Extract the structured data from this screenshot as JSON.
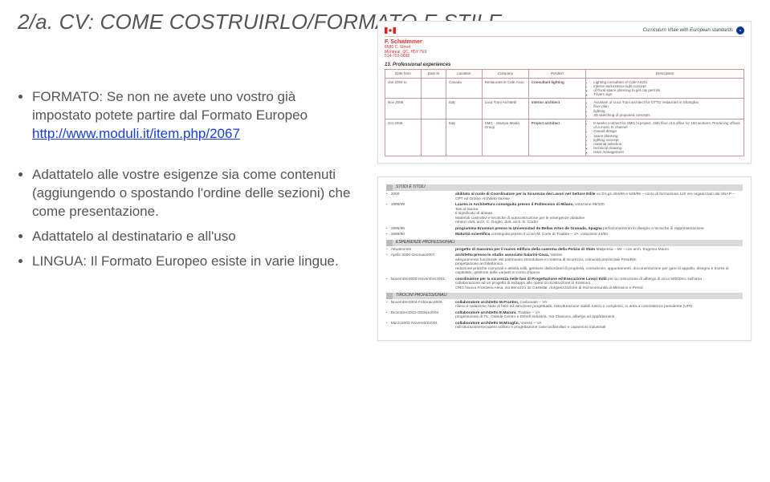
{
  "title": "2/a. CV: COME COSTRUIRLO/FORMATO E STILE",
  "bullets": {
    "b1_line1": "FORMATO: Se non ne avete uno vostro già impostato potete partire dal Formato Europeo",
    "b1_link": "http://www.moduli.it/item.php/2067",
    "b2": "Adattatelo alle vostre esigenze sia come contenuti (aggiungendo o spostando l'ordine delle sezioni) che come presentazione.",
    "b3": "Adattatelo al destinatario e all'uso",
    "b4": "LINGUA: Il Formato Europeo esiste in varie lingue."
  },
  "cv1": {
    "header_label": "Curriculum Vitae with European standards",
    "name": "F. Schwimmer",
    "addr1": "6586 C. Street",
    "addr2": "Montreal, QC, H5Y 7E9",
    "addr3": "514-703-0888",
    "section": "13. Professional experiences",
    "head": {
      "df": "Date from",
      "dt": "Date to",
      "loc": "Location",
      "co": "Company",
      "pos": "Position",
      "desc": "Description"
    },
    "rows": [
      {
        "df": "Jan 2009 to",
        "dt": "",
        "loc": "Canada",
        "co": "Restaurant et Cafe Asou",
        "pos": "Consultant lighting",
        "desc": [
          "Lighting consultant of Cafe ASOU",
          "interior and exterior light concept",
          "of floral space planning to get city permits",
          "Trivers sign"
        ]
      },
      {
        "df": "Nov 2008",
        "dt": "",
        "loc": "Italy",
        "co": "Luca Trani Architetti",
        "pos": "Interior architect",
        "desc": [
          "Assistant of Luca Trani architect for OTTO restaurant in Shanghai",
          "floor plan",
          "lighting",
          "3D sketching of proposed concepts"
        ]
      },
      {
        "df": "Oct 2008",
        "dt": "",
        "loc": "Italy",
        "co": "SMG - Stampa Media Group",
        "pos": "Project architect",
        "desc": [
          "8 weeks contract for SMG hi project. 15th floor of a office for 150 workers. Producing offices of a music tv channel",
          "Overall design",
          "space planning",
          "lighting concept",
          "material selection",
          "technical drawing",
          "team management"
        ]
      }
    ]
  },
  "cv2": {
    "sections": [
      {
        "title": "STUDI E TITOLI",
        "rows": [
          {
            "date": "2000",
            "bold": "abilitato al ruolo di Coordinatore per la Sicurezza dei Lavori nel Settore Edile",
            "rest": "ex D.Lgs 494/96 e 528/99 – corso di formazione 120 ore organizzato dal SNAP – CPT ed Ordine Architetti Varese"
          },
          {
            "date": "1998/99",
            "bold": "Laurea in Architettura conseguita presso il Politecnico di Milano,",
            "rest": "votazione 98/100\nTesi di laurea\nIl significato di abitare.\nMateriali costruttivi e tecniche di autocostruzione per le emergenze abitative\nrelatori dott. arch. C. Goglio, dott. arch. E. Corbo"
          },
          {
            "date": "1995/96",
            "bold": "programma Erasmus presso la Universidad de Bellas Artes de Granada, Spagna",
            "rest": "perfezionamento in disegno e tecniche di rappresentazione"
          },
          {
            "date": "1989/90",
            "bold": "Maturità scientifica",
            "rest": "conseguita presso il Liceo M. Curie di Tradate – VA, votazione 44/60"
          }
        ]
      },
      {
        "title": "ESPERIENZE PROFESSIONALI",
        "rows": [
          {
            "date": "Attualmente",
            "bold": "progetto di massima per il nuovo edificio della caserma della Polizia di Stato",
            "rest": "Malpensa – MI – con arch. Eugenio Mauro"
          },
          {
            "date": "Aprile 2006-Gennaio2007",
            "bold": "architetto presso lo studio associato Salarini-Cova,",
            "rest": "Varese\nadeguamento funzionale del patrimonio immobiliare in materia di sicurezza, comunità provinciale PresiRSI\nprogettazione architettonica\nredazione pratiche comunali e attività edili, gestione disbordanti di proprietà, consulenze, appuntamenti, documentazione per gare di appalto, disegno e bozze di capitolato, gestione delle varianti in corso d'opera"
          },
          {
            "date": "Novembre2000-Novembre2001",
            "bold": "coordinatore per la sicurezza nelle fasi di Progettazione ed Esecuzione Lavori Edili",
            "rest": "per la costruzione di albergo di circa 50000mc sull'area\ncollaborazione ad un progetto di sviluppo alle opere di ricostruzione in Kossovo\nONG Nuova Frontiera-Ateia, via Benozzo 32 Castellar, riorganizzazione di microcomunità di Mitrovice e Pered"
          }
        ]
      },
      {
        "title": "TIROCINI PROFESSIONALI",
        "rows": [
          {
            "date": "Novembre2004-Febbraio2005",
            "bold": "collaboratore architetto M.Frantini,",
            "rest": "Carbonate – VA\nrilievo e redazione stato di fatto ed istruzione progettuale, ristrutturazione stabili rustici e complessi, in area a committenza prevalente (UPI)"
          },
          {
            "date": "Dicembre2003-Ottobre2004",
            "bold": "collaboratore architetto E.Maroni,",
            "rest": "Tradate – VA\nprogettazione di PL, Oulede Centro e Dshell Industria, Via Clausura, albergo ed appartamenti"
          },
          {
            "date": "Marzo2001-Novembre2001",
            "bold": "collaboratore architetto M.Miraglio,",
            "rest": "Varese – VA\nristrutturazione/recupero edilizio e progettazione case unifamiliari e capannoni industriali"
          }
        ]
      }
    ]
  }
}
